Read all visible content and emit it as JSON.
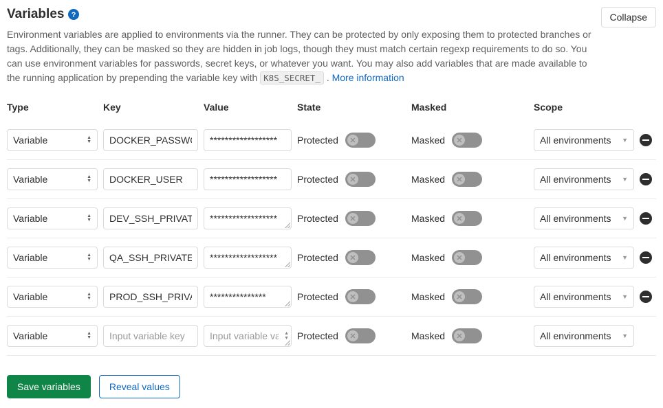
{
  "header": {
    "title": "Variables",
    "collapse": "Collapse"
  },
  "desc": {
    "line1": "Environment variables are applied to environments via the runner. They can be protected by only exposing them to protected branches or tags. Additionally, they can be masked so they are hidden in job logs, though they must match certain regexp requirements to do so. You can use environment variables for passwords, secret keys, or whatever you want. You may also add variables that are made available to the running application by prepending the variable key with ",
    "code": "K8S_SECRET_",
    "tail": " . ",
    "link": "More information"
  },
  "columns": {
    "type": "Type",
    "key": "Key",
    "value": "Value",
    "state": "State",
    "masked": "Masked",
    "scope": "Scope"
  },
  "labels": {
    "protected": "Protected",
    "masked": "Masked",
    "type_option": "Variable",
    "scope_option": "All environments",
    "key_placeholder": "Input variable key",
    "value_placeholder": "Input variable value"
  },
  "rows": [
    {
      "key": "DOCKER_PASSWORD",
      "value": "******************",
      "multiline": false,
      "removable": true
    },
    {
      "key": "DOCKER_USER",
      "value": "******************",
      "multiline": false,
      "removable": true
    },
    {
      "key": "DEV_SSH_PRIVATE_KEY",
      "value": "******************",
      "multiline": true,
      "removable": true
    },
    {
      "key": "QA_SSH_PRIVATE_KEY",
      "value": "******************",
      "multiline": true,
      "removable": true
    },
    {
      "key": "PROD_SSH_PRIVATE_KEY",
      "value": "***************",
      "multiline": true,
      "removable": true
    },
    {
      "key": "",
      "value": "",
      "multiline": true,
      "removable": false,
      "spinner": true
    }
  ],
  "footer": {
    "save": "Save variables",
    "reveal": "Reveal values"
  }
}
